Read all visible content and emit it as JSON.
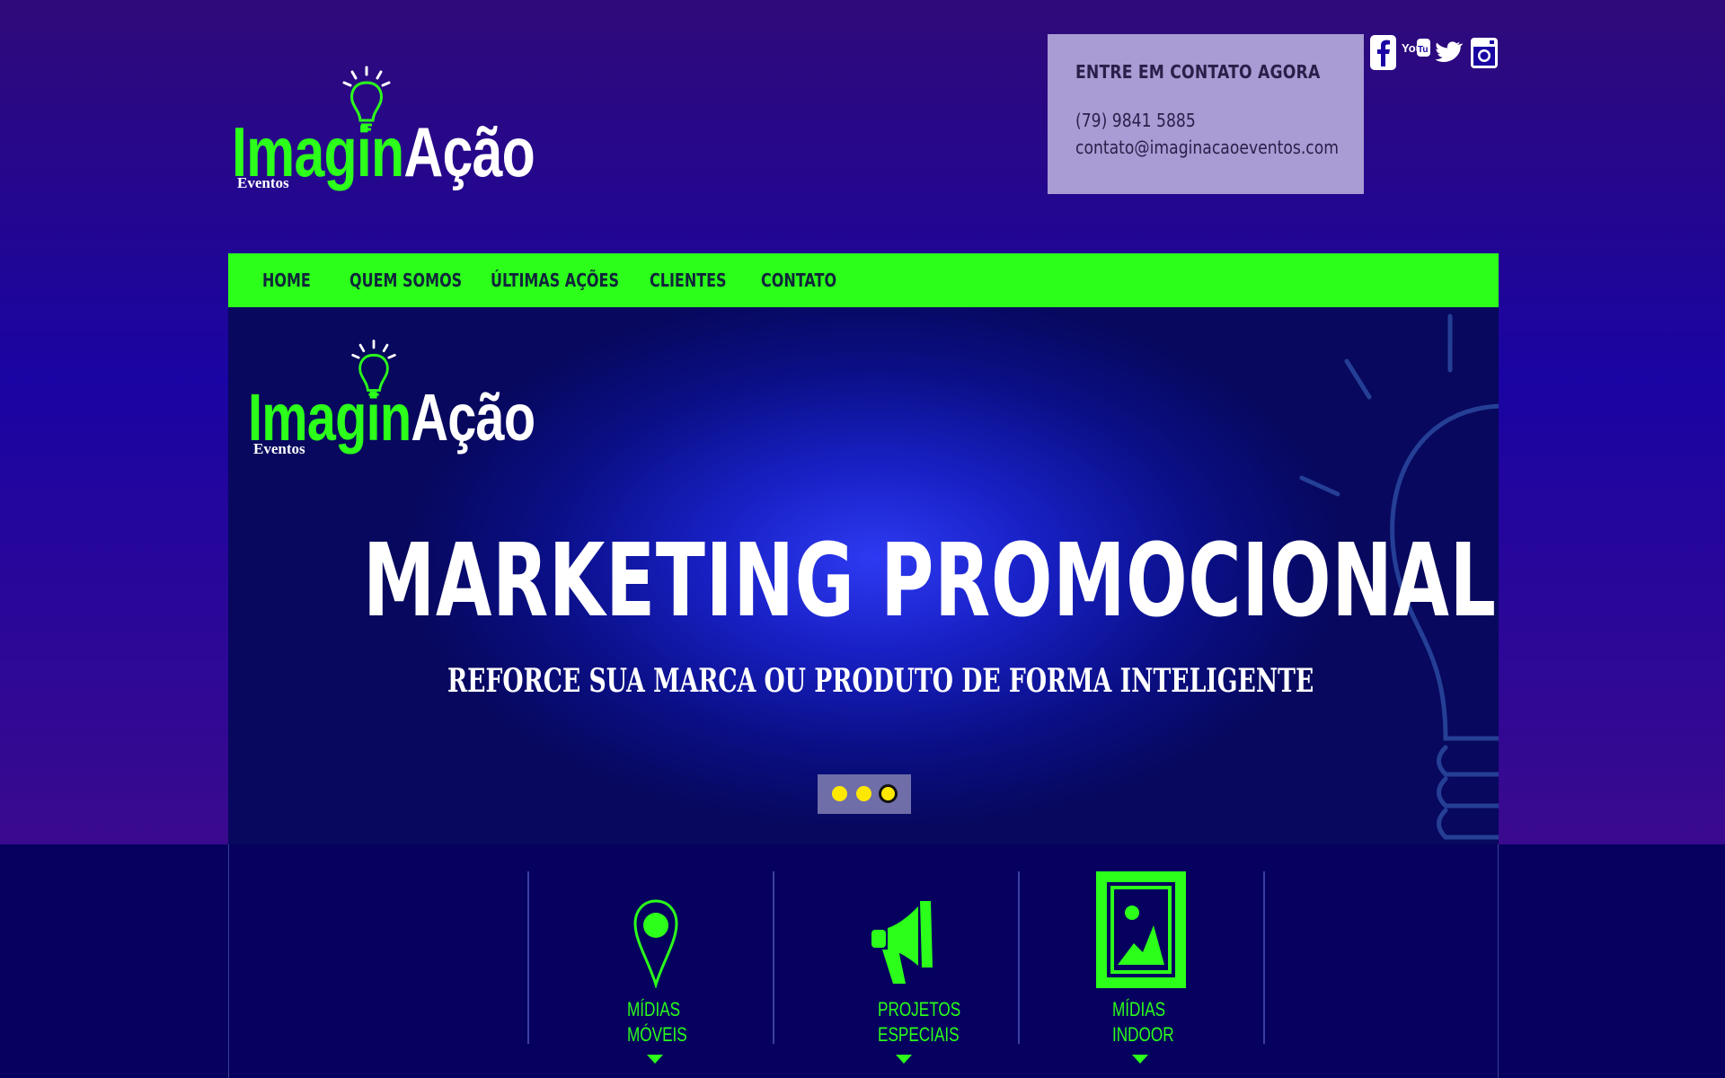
{
  "brand": {
    "word_green": "Imagin",
    "word_white": "Ação",
    "subtitle": "Eventos",
    "color_green": "#2bff1a"
  },
  "contact": {
    "title": "ENTRE EM CONTATO AGORA",
    "phone": "(79) 9841 5885",
    "email": "contato@imaginacaoeventos.com"
  },
  "social": [
    "facebook-icon",
    "youtube-icon",
    "twitter-icon",
    "instagram-icon"
  ],
  "nav": {
    "items": [
      "HOME",
      "QUEM SOMOS",
      "ÚLTIMAS AÇÕES",
      "CLIENTES",
      "CONTATO"
    ]
  },
  "hero": {
    "title": "MARKETING PROMOCIONAL",
    "subtitle": "REFORCE SUA MARCA OU PRODUTO DE FORMA INTELIGENTE",
    "slides": 3,
    "active_slide": 3
  },
  "services": [
    {
      "line1": "MÍDIAS",
      "line2": "MÓVEIS",
      "icon": "map-pin-icon"
    },
    {
      "line1": "PROJETOS",
      "line2": "ESPECIAIS",
      "icon": "megaphone-icon"
    },
    {
      "line1": "MÍDIAS",
      "line2": "INDOOR",
      "icon": "image-frame-icon"
    }
  ]
}
